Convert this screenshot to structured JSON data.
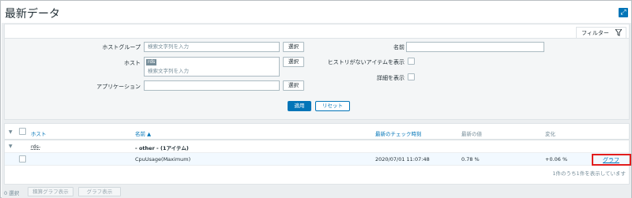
{
  "page": {
    "title": "最新データ"
  },
  "filter": {
    "tab_label": "フィルター",
    "host_group_label": "ホストグループ",
    "host_group_placeholder": "検索文字列を入力",
    "host_label": "ホスト",
    "host_tag": "rds",
    "host_placeholder": "検索文字列を入力",
    "application_label": "アプリケーション",
    "application_value": "",
    "select_label": "選択",
    "name_label": "名前",
    "name_value": "",
    "no_history_label": "ヒストリがないアイテムを表示",
    "details_label": "詳細を表示",
    "apply_label": "適用",
    "reset_label": "リセット"
  },
  "table": {
    "columns": {
      "host": "ホスト",
      "name": "名前 ▲",
      "last_check": "最新のチェック時刻",
      "last_value": "最新の値",
      "change": "変化"
    },
    "group": {
      "host": "rds-",
      "label": "- other - (1アイテム)"
    },
    "rows": [
      {
        "name": "CpuUsage(Maximum)",
        "last_check": "2020/07/01 11:07:48",
        "last_value": "0.78 %",
        "change": "+0.06 %",
        "graph_label": "グラフ"
      }
    ],
    "summary": "1件のうち1件を表示しています"
  },
  "footer": {
    "selected_count": "0 選択",
    "stacked_graph_label": "積算グラフ表示",
    "graph_label": "グラフ表示"
  },
  "colors": {
    "accent": "#0275b8",
    "highlight_border": "#e21d1d"
  }
}
